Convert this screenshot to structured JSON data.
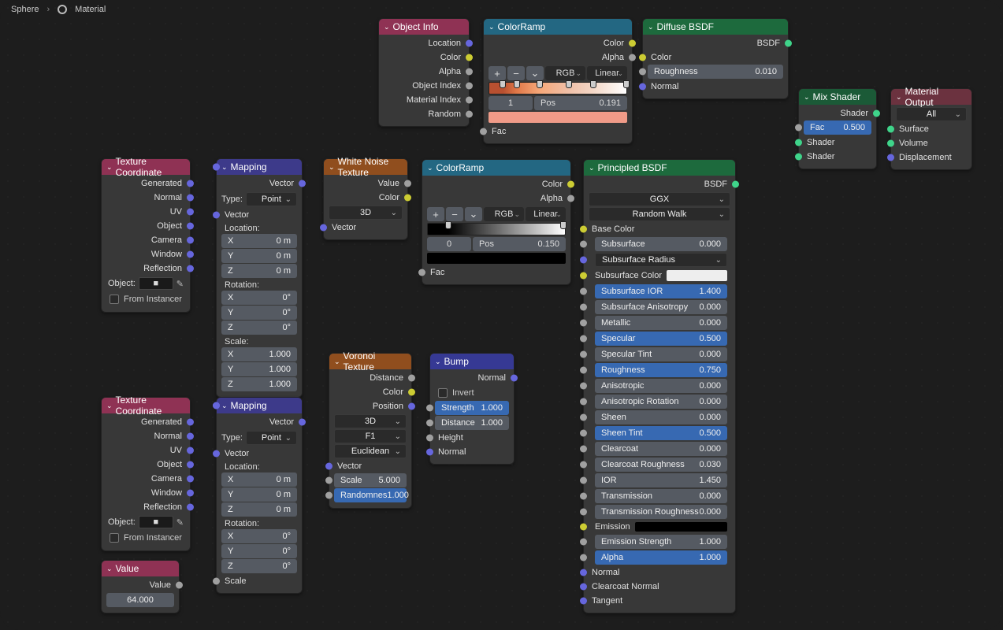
{
  "breadcrumb": {
    "object": "Sphere",
    "material": "Material"
  },
  "nodes": {
    "objectInfo": {
      "title": "Object Info",
      "outputs": [
        "Location",
        "Color",
        "Alpha",
        "Object Index",
        "Material Index",
        "Random"
      ]
    },
    "colorRamp1": {
      "title": "ColorRamp",
      "outputs": [
        "Color",
        "Alpha"
      ],
      "input": "Fac",
      "plus": "+",
      "minus": "−",
      "caret": "⌄",
      "mode": "RGB",
      "interp": "Linear",
      "posIndex": "1",
      "posLabel": "Pos",
      "posValue": "0.191",
      "stops": [
        {
          "p": 10,
          "c": "#b85030"
        },
        {
          "p": 20,
          "c": "#e07848"
        },
        {
          "p": 37,
          "c": "#f6a87a"
        },
        {
          "p": 58,
          "c": "#f0c0a8"
        },
        {
          "p": 76,
          "c": "#f4d8c8"
        },
        {
          "p": 100,
          "c": "#ffffff"
        }
      ],
      "swatchColor": "#f09b88"
    },
    "diffuseBSDF": {
      "title": "Diffuse BSDF",
      "output": "BSDF",
      "colorLabel": "Color",
      "roughness": {
        "label": "Roughness",
        "value": "0.010"
      },
      "normal": "Normal"
    },
    "mixShader": {
      "title": "Mix Shader",
      "output": "Shader",
      "fac": {
        "label": "Fac",
        "value": "0.500"
      },
      "in1": "Shader",
      "in2": "Shader"
    },
    "materialOutput": {
      "title": "Material Output",
      "target": "All",
      "inputs": [
        "Surface",
        "Volume",
        "Displacement"
      ]
    },
    "texCoord1": {
      "title": "Texture Coordinate",
      "outputs": [
        "Generated",
        "Normal",
        "UV",
        "Object",
        "Camera",
        "Window",
        "Reflection"
      ],
      "objectLabel": "Object:",
      "fromInstancer": "From Instancer"
    },
    "mapping1": {
      "title": "Mapping",
      "output": "Vector",
      "typeLabel": "Type:",
      "typeValue": "Point",
      "vectorLabel": "Vector",
      "locLabel": "Location:",
      "rotLabel": "Rotation:",
      "scaleLabel": "Scale:",
      "loc": [
        {
          "a": "X",
          "v": "0 m"
        },
        {
          "a": "Y",
          "v": "0 m"
        },
        {
          "a": "Z",
          "v": "0 m"
        }
      ],
      "rot": [
        {
          "a": "X",
          "v": "0°"
        },
        {
          "a": "Y",
          "v": "0°"
        },
        {
          "a": "Z",
          "v": "0°"
        }
      ],
      "scale": [
        {
          "a": "X",
          "v": "1.000"
        },
        {
          "a": "Y",
          "v": "1.000"
        },
        {
          "a": "Z",
          "v": "1.000"
        }
      ]
    },
    "whiteNoise": {
      "title": "White Noise Texture",
      "outputs": [
        "Value",
        "Color"
      ],
      "dim": "3D",
      "vectorLabel": "Vector"
    },
    "colorRamp2": {
      "title": "ColorRamp",
      "outputs": [
        "Color",
        "Alpha"
      ],
      "input": "Fac",
      "plus": "+",
      "minus": "−",
      "caret": "⌄",
      "mode": "RGB",
      "interp": "Linear",
      "posIndex": "0",
      "posLabel": "Pos",
      "posValue": "0.150",
      "swatchColor": "#000000"
    },
    "principled": {
      "title": "Principled BSDF",
      "output": "BSDF",
      "distribution": "GGX",
      "subsurfaceMethod": "Random Walk",
      "baseColorLabel": "Base Color",
      "subsurfaceColorLabel": "Subsurface Color",
      "emissionLabel": "Emission",
      "normalLabel": "Normal",
      "clearcoatNormalLabel": "Clearcoat Normal",
      "tangentLabel": "Tangent",
      "subsurfaceRadiusLabel": "Subsurface Radius",
      "props": [
        {
          "name": "Subsurface",
          "value": "0.000",
          "blue": false
        },
        {
          "name": "Subsurface IOR",
          "value": "1.400",
          "blue": true
        },
        {
          "name": "Subsurface Anisotropy",
          "value": "0.000",
          "blue": false
        },
        {
          "name": "Metallic",
          "value": "0.000",
          "blue": false
        },
        {
          "name": "Specular",
          "value": "0.500",
          "blue": true
        },
        {
          "name": "Specular Tint",
          "value": "0.000",
          "blue": false
        },
        {
          "name": "Roughness",
          "value": "0.750",
          "blue": true
        },
        {
          "name": "Anisotropic",
          "value": "0.000",
          "blue": false
        },
        {
          "name": "Anisotropic Rotation",
          "value": "0.000",
          "blue": false
        },
        {
          "name": "Sheen",
          "value": "0.000",
          "blue": false
        },
        {
          "name": "Sheen Tint",
          "value": "0.500",
          "blue": true
        },
        {
          "name": "Clearcoat",
          "value": "0.000",
          "blue": false
        },
        {
          "name": "Clearcoat Roughness",
          "value": "0.030",
          "blue": false
        },
        {
          "name": "IOR",
          "value": "1.450",
          "blue": false
        },
        {
          "name": "Transmission",
          "value": "0.000",
          "blue": false
        },
        {
          "name": "Transmission Roughness",
          "value": "0.000",
          "blue": false
        }
      ],
      "emissionStrength": {
        "name": "Emission Strength",
        "value": "1.000"
      },
      "alpha": {
        "name": "Alpha",
        "value": "1.000"
      }
    },
    "texCoord2": {
      "title": "Texture Coordinate",
      "outputs": [
        "Generated",
        "Normal",
        "UV",
        "Object",
        "Camera",
        "Window",
        "Reflection"
      ],
      "objectLabel": "Object:",
      "fromInstancer": "From Instancer"
    },
    "mapping2": {
      "title": "Mapping",
      "output": "Vector",
      "typeLabel": "Type:",
      "typeValue": "Point",
      "vectorLabel": "Vector",
      "locLabel": "Location:",
      "rotLabel": "Rotation:",
      "scaleLabel": "Scale:",
      "loc": [
        {
          "a": "X",
          "v": "0 m"
        },
        {
          "a": "Y",
          "v": "0 m"
        },
        {
          "a": "Z",
          "v": "0 m"
        }
      ],
      "rot": [
        {
          "a": "X",
          "v": "0°"
        },
        {
          "a": "Y",
          "v": "0°"
        },
        {
          "a": "Z",
          "v": "0°"
        }
      ]
    },
    "value": {
      "title": "Value",
      "output": "Value",
      "value": "64.000"
    },
    "voronoi": {
      "title": "Voronoi Texture",
      "outputs": [
        "Distance",
        "Color",
        "Position"
      ],
      "dim": "3D",
      "feat": "F1",
      "metric": "Euclidean",
      "vectorLabel": "Vector",
      "scale": {
        "label": "Scale",
        "value": "5.000"
      },
      "randomness": {
        "label": "Randomnes",
        "value": "1.000"
      }
    },
    "bump": {
      "title": "Bump",
      "output": "Normal",
      "invert": "Invert",
      "strength": {
        "label": "Strength",
        "value": "1.000"
      },
      "distance": {
        "label": "Distance",
        "value": "1.000"
      },
      "height": "Height",
      "normal": "Normal"
    }
  }
}
